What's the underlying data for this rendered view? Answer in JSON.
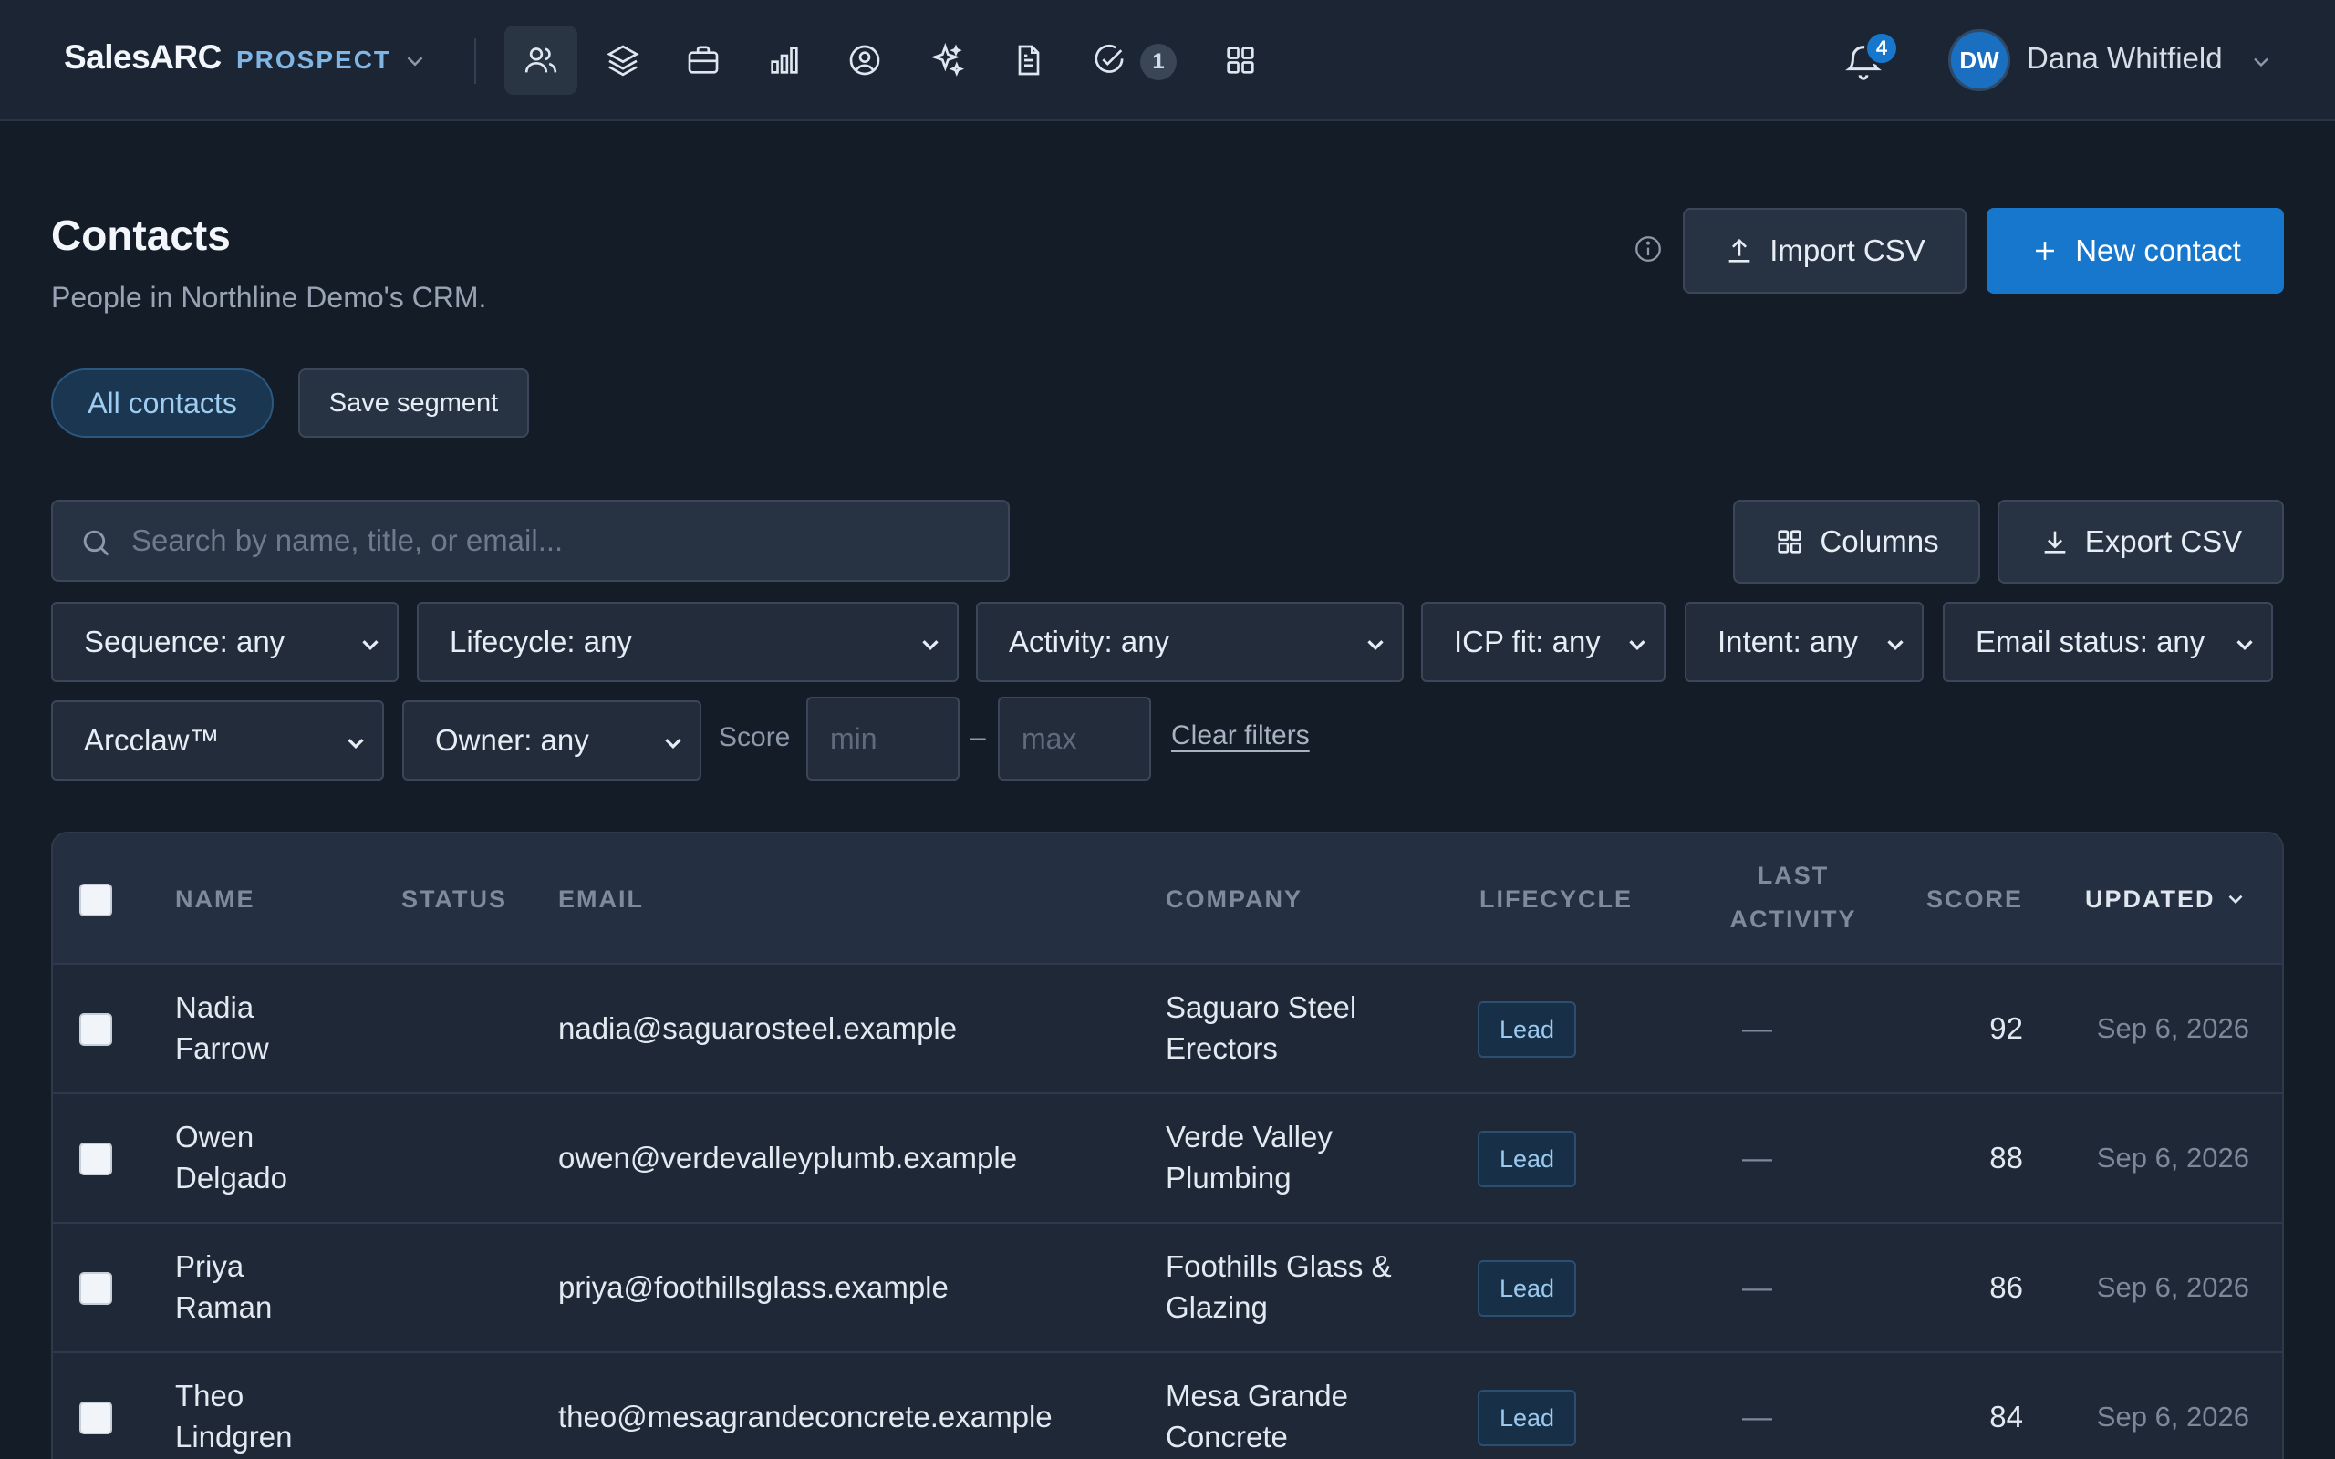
{
  "app": {
    "brand": "SalesARC",
    "product": "PROSPECT",
    "nav_badge": "1",
    "notification_count": "4",
    "user_initials": "DW",
    "user_name": "Dana Whitfield"
  },
  "nav_icons": [
    "users-icon",
    "layers-icon",
    "briefcase-icon",
    "bar-chart-icon",
    "user-circle-icon",
    "sparkles-icon",
    "document-icon",
    "check-circle-icon",
    "grid-icon"
  ],
  "page": {
    "title": "Contacts",
    "subtitle": "People in Northline Demo's CRM.",
    "import_label": "Import CSV",
    "new_label": "New contact"
  },
  "segments": {
    "active": "All contacts",
    "save_label": "Save segment"
  },
  "toolbar": {
    "search_placeholder": "Search by name, title, or email...",
    "columns_label": "Columns",
    "export_label": "Export CSV"
  },
  "filters": {
    "sequence": "Sequence: any",
    "lifecycle": "Lifecycle: any",
    "activity": "Activity: any",
    "icp": "ICP fit: any",
    "intent": "Intent: any",
    "email_status": "Email status: any",
    "arcclaw": "Arcclaw™",
    "owner": "Owner: any",
    "score_label": "Score",
    "min_placeholder": "min",
    "dash": "–",
    "max_placeholder": "max",
    "clear_label": "Clear filters"
  },
  "table": {
    "headers": {
      "name": "NAME",
      "status": "STATUS",
      "email": "EMAIL",
      "company": "COMPANY",
      "lifecycle": "LIFECYCLE",
      "last_activity_1": "LAST",
      "last_activity_2": "ACTIVITY",
      "score": "SCORE",
      "updated": "UPDATED"
    },
    "rows": [
      {
        "first": "Nadia",
        "last": "Farrow",
        "email": "nadia@saguarosteel.example",
        "company_1": "Saguaro Steel",
        "company_2": "Erectors",
        "lifecycle": "Lead",
        "activity": "—",
        "score": "92",
        "updated": "Sep 6, 2026"
      },
      {
        "first": "Owen",
        "last": "Delgado",
        "email": "owen@verdevalleyplumb.example",
        "company_1": "Verde Valley",
        "company_2": "Plumbing",
        "lifecycle": "Lead",
        "activity": "—",
        "score": "88",
        "updated": "Sep 6, 2026"
      },
      {
        "first": "Priya",
        "last": "Raman",
        "email": "priya@foothillsglass.example",
        "company_1": "Foothills Glass &",
        "company_2": "Glazing",
        "lifecycle": "Lead",
        "activity": "—",
        "score": "86",
        "updated": "Sep 6, 2026"
      },
      {
        "first": "Theo",
        "last": "Lindgren",
        "email": "theo@mesagrandeconcrete.example",
        "company_1": "Mesa Grande",
        "company_2": "Concrete",
        "lifecycle": "Lead",
        "activity": "—",
        "score": "84",
        "updated": "Sep 6, 2026"
      }
    ]
  },
  "colors": {
    "background": "#141c27",
    "topbar": "#1b2533",
    "accent": "#1677cc",
    "badge_text": "#9cc9ef"
  }
}
